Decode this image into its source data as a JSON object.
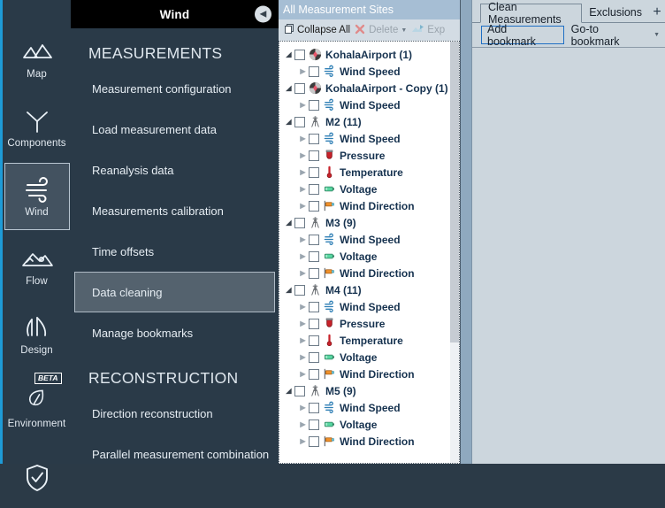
{
  "rail": {
    "items": [
      {
        "label": "Map",
        "icon": "mountains-icon",
        "active": false,
        "beta": false
      },
      {
        "label": "Components",
        "icon": "turbine-icon",
        "active": false,
        "beta": false
      },
      {
        "label": "Wind",
        "icon": "wind-icon",
        "active": true,
        "beta": false
      },
      {
        "label": "Flow",
        "icon": "flow-terrain-icon",
        "active": false,
        "beta": false
      },
      {
        "label": "Design",
        "icon": "design-rotor-icon",
        "active": false,
        "beta": false
      },
      {
        "label": "Environment",
        "icon": "leaf-icon",
        "active": false,
        "beta": true,
        "beta_label": "BETA"
      },
      {
        "label": "",
        "icon": "shield-check-icon",
        "active": false,
        "beta": false
      }
    ]
  },
  "menu": {
    "title": "Wind",
    "collapse_icon": "chevron-left-icon",
    "sections": [
      {
        "heading": "MEASUREMENTS",
        "items": [
          {
            "label": "Measurement configuration",
            "selected": false
          },
          {
            "label": "Load measurement data",
            "selected": false
          },
          {
            "label": "Reanalysis data",
            "selected": false
          },
          {
            "label": "Measurements calibration",
            "selected": false
          },
          {
            "label": "Time offsets",
            "selected": false
          },
          {
            "label": "Data cleaning",
            "selected": true
          },
          {
            "label": "Manage bookmarks",
            "selected": false
          }
        ]
      },
      {
        "heading": "RECONSTRUCTION",
        "items": [
          {
            "label": "Direction reconstruction",
            "selected": false
          },
          {
            "label": "Parallel measurement combination",
            "selected": false
          }
        ]
      }
    ]
  },
  "tree": {
    "header": "All Measurement Sites",
    "toolbar": [
      {
        "label": "Collapse All",
        "icon": "collapse-all-icon",
        "disabled": false,
        "caret": false
      },
      {
        "label": "Delete",
        "icon": "delete-x-icon",
        "disabled": true,
        "caret": true
      },
      {
        "label": "Exp",
        "icon": "export-icon",
        "disabled": true,
        "caret": false
      }
    ],
    "nodes": [
      {
        "label": "KohalaAirport (1)",
        "icon": "site-radar-icon",
        "level": 0,
        "expander": "open",
        "checked": false
      },
      {
        "label": "Wind Speed",
        "icon": "wind-speed-icon",
        "level": 1,
        "expander": "closed",
        "checked": false
      },
      {
        "label": "KohalaAirport - Copy (1)",
        "icon": "site-radar-icon",
        "level": 0,
        "expander": "open",
        "checked": false
      },
      {
        "label": "Wind Speed",
        "icon": "wind-speed-icon",
        "level": 1,
        "expander": "closed",
        "checked": false
      },
      {
        "label": "M2 (11)",
        "icon": "mast-icon",
        "level": 0,
        "expander": "open",
        "checked": false
      },
      {
        "label": "Wind Speed",
        "icon": "wind-speed-icon",
        "level": 1,
        "expander": "closed",
        "checked": false
      },
      {
        "label": "Pressure",
        "icon": "pressure-icon",
        "level": 1,
        "expander": "closed",
        "checked": false
      },
      {
        "label": "Temperature",
        "icon": "temperature-icon",
        "level": 1,
        "expander": "closed",
        "checked": false
      },
      {
        "label": "Voltage",
        "icon": "voltage-icon",
        "level": 1,
        "expander": "closed",
        "checked": false
      },
      {
        "label": "Wind Direction",
        "icon": "wind-direction-icon",
        "level": 1,
        "expander": "closed",
        "checked": false
      },
      {
        "label": "M3 (9)",
        "icon": "mast-icon",
        "level": 0,
        "expander": "open",
        "checked": false
      },
      {
        "label": "Wind Speed",
        "icon": "wind-speed-icon",
        "level": 1,
        "expander": "closed",
        "checked": false
      },
      {
        "label": "Voltage",
        "icon": "voltage-icon",
        "level": 1,
        "expander": "closed",
        "checked": false
      },
      {
        "label": "Wind Direction",
        "icon": "wind-direction-icon",
        "level": 1,
        "expander": "closed",
        "checked": false
      },
      {
        "label": "M4 (11)",
        "icon": "mast-icon",
        "level": 0,
        "expander": "open",
        "checked": false
      },
      {
        "label": "Wind Speed",
        "icon": "wind-speed-icon",
        "level": 1,
        "expander": "closed",
        "checked": false
      },
      {
        "label": "Pressure",
        "icon": "pressure-icon",
        "level": 1,
        "expander": "closed",
        "checked": false
      },
      {
        "label": "Temperature",
        "icon": "temperature-icon",
        "level": 1,
        "expander": "closed",
        "checked": false
      },
      {
        "label": "Voltage",
        "icon": "voltage-icon",
        "level": 1,
        "expander": "closed",
        "checked": false
      },
      {
        "label": "Wind Direction",
        "icon": "wind-direction-icon",
        "level": 1,
        "expander": "closed",
        "checked": false
      },
      {
        "label": "M5 (9)",
        "icon": "mast-icon",
        "level": 0,
        "expander": "open",
        "checked": false
      },
      {
        "label": "Wind Speed",
        "icon": "wind-speed-icon",
        "level": 1,
        "expander": "closed",
        "checked": false
      },
      {
        "label": "Voltage",
        "icon": "voltage-icon",
        "level": 1,
        "expander": "closed",
        "checked": false
      },
      {
        "label": "Wind Direction",
        "icon": "wind-direction-icon",
        "level": 1,
        "expander": "closed",
        "checked": false
      }
    ]
  },
  "right": {
    "tabs": [
      {
        "label": "Clean Measurements",
        "active": true
      },
      {
        "label": "Exclusions",
        "active": false
      }
    ],
    "add_tab_icon": "plus-icon",
    "buttons": [
      {
        "label": "Add bookmark",
        "focused": true,
        "caret": false
      },
      {
        "label": "Go-to bookmark",
        "focused": false,
        "caret": true
      }
    ]
  },
  "colors": {
    "rail_bg": "#2a3a48",
    "accent": "#1e9bd7",
    "menu_title_bg": "#000000",
    "tree_header_bg": "#a6bed4",
    "panel_bg": "#ccd6dd",
    "focus_blue": "#1f6fc4",
    "selected_item": "#54626e"
  }
}
